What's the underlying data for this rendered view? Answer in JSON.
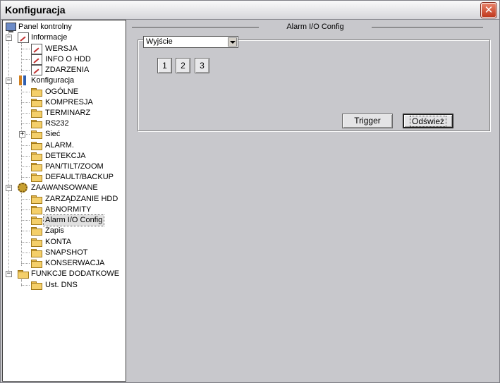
{
  "window": {
    "title": "Konfiguracja"
  },
  "tree": {
    "root": "Panel kontrolny",
    "items": [
      {
        "label": "Informacje"
      },
      {
        "label": "WERSJA"
      },
      {
        "label": "INFO O HDD"
      },
      {
        "label": "ZDARZENIA"
      },
      {
        "label": "Konfiguracja"
      },
      {
        "label": "OGÓLNE"
      },
      {
        "label": "KOMPRESJA"
      },
      {
        "label": "TERMINARZ"
      },
      {
        "label": "RS232"
      },
      {
        "label": "Sieć"
      },
      {
        "label": "ALARM."
      },
      {
        "label": "DETEKCJA"
      },
      {
        "label": "PAN/TILT/ZOOM"
      },
      {
        "label": "DEFAULT/BACKUP"
      },
      {
        "label": "ZAAWANSOWANE"
      },
      {
        "label": "ZARZĄDZANIE HDD"
      },
      {
        "label": "ABNORMITY"
      },
      {
        "label": "Alarm I/O Config"
      },
      {
        "label": "Zapis"
      },
      {
        "label": "KONTA"
      },
      {
        "label": "SNAPSHOT"
      },
      {
        "label": "KONSERWACJA"
      },
      {
        "label": "FUNKCJE DODATKOWE"
      },
      {
        "label": "Ust. DNS"
      }
    ],
    "selected": "Alarm I/O Config"
  },
  "panel": {
    "title": "Alarm I/O Config",
    "select_value": "Wyjście",
    "channels": [
      "1",
      "2",
      "3"
    ],
    "trigger_label": "Trigger",
    "refresh_label": "Odśwież"
  },
  "colors": {
    "background": "#c8c8cc",
    "tree_bg": "#ffffff",
    "close": "#c0391e"
  },
  "icons": {
    "close": "close-icon",
    "root": "computer-icon",
    "info": "document-edit-icon",
    "config": "tools-icon",
    "advanced": "gear-icon",
    "folder": "folder-icon"
  }
}
